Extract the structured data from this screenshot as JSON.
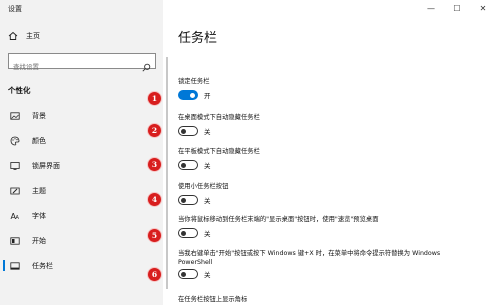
{
  "window": {
    "title": "设置",
    "controls": {
      "minimize": "—",
      "maximize": "☐",
      "close": "✕"
    }
  },
  "sidebar": {
    "home_label": "主页",
    "search_placeholder": "查找设置",
    "section_header": "个性化",
    "items": [
      {
        "label": "背景",
        "icon": "image-icon"
      },
      {
        "label": "颜色",
        "icon": "palette-icon"
      },
      {
        "label": "锁屏界面",
        "icon": "lock-screen-icon"
      },
      {
        "label": "主题",
        "icon": "brush-icon"
      },
      {
        "label": "字体",
        "icon": "font-icon"
      },
      {
        "label": "开始",
        "icon": "start-menu-icon"
      },
      {
        "label": "任务栏",
        "icon": "taskbar-icon",
        "active": true
      }
    ]
  },
  "main": {
    "title": "任务栏",
    "settings": [
      {
        "label": "锁定任务栏",
        "state": "开",
        "on": true
      },
      {
        "label": "在桌面模式下自动隐藏任务栏",
        "state": "关",
        "on": false
      },
      {
        "label": "在平板模式下自动隐藏任务栏",
        "state": "关",
        "on": false
      },
      {
        "label": "使用小任务栏按钮",
        "state": "关",
        "on": false
      },
      {
        "label": "当你将鼠标移动到任务栏末端的\"显示桌面\"按钮时，使用\"速览\"预览桌面",
        "state": "关",
        "on": false
      },
      {
        "label": "当我右键单击\"开始\"按钮或按下 Windows 键+X 时，在菜单中将命令提示符替换为 Windows PowerShell",
        "state": "关",
        "on": false
      },
      {
        "label": "在任务栏按钮上显示角标"
      }
    ]
  },
  "markers": [
    "1",
    "2",
    "3",
    "4",
    "5",
    "6"
  ],
  "colors": {
    "accent": "#0078d7",
    "marker": "#d81e1e",
    "sidebar_bg": "#f2f2f2"
  }
}
